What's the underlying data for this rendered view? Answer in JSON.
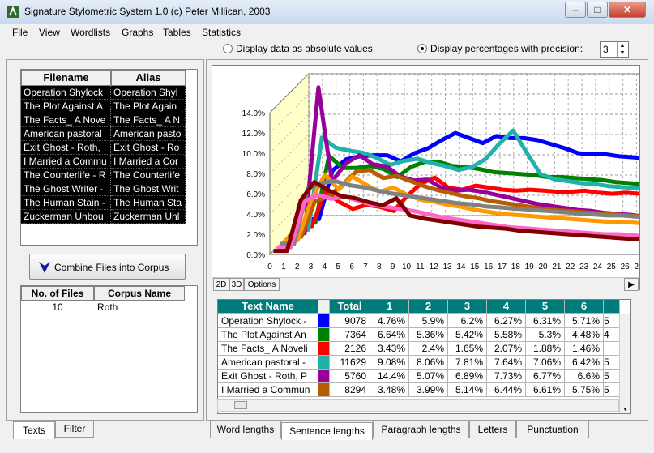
{
  "window": {
    "title": "Signature Stylometric System 1.0  (c) Peter Millican, 2003",
    "min_glyph": "–",
    "max_glyph": "□",
    "close_glyph": "✕"
  },
  "menu": [
    "File",
    "View",
    "Wordlists",
    "Graphs",
    "Tables",
    "Statistics"
  ],
  "options": {
    "absolute_label": "Display data as absolute values",
    "percent_label": "Display percentages with precision:",
    "precision": "3",
    "selected": "percent"
  },
  "file_list": {
    "headers": [
      "Filename",
      "Alias"
    ],
    "rows": [
      [
        "Operation Shylock",
        "Operation Shyl"
      ],
      [
        "The Plot Against A",
        "The Plot Again"
      ],
      [
        "The Facts_ A Nove",
        "The Facts_ A N"
      ],
      [
        "American pastoral",
        "American pasto"
      ],
      [
        "Exit Ghost - Roth,",
        "Exit Ghost - Ro"
      ],
      [
        "I Married a Commu",
        "I Married a Cor"
      ],
      [
        "The Counterlife - R",
        "The Counterlife"
      ],
      [
        "The Ghost Writer -",
        "The Ghost Writ"
      ],
      [
        "The Human Stain -",
        "The Human Sta"
      ],
      [
        "Zuckerman Unbou",
        "Zuckerman Unl"
      ]
    ]
  },
  "combine_button": "Combine Files into Corpus",
  "corpus_table": {
    "headers": [
      "No. of Files",
      "Corpus Name"
    ],
    "rows": [
      [
        "10",
        "Roth"
      ]
    ]
  },
  "left_tabs": [
    "Texts",
    "Filter"
  ],
  "bottom_tabs": [
    "Word lengths",
    "Sentence lengths",
    "Paragraph lengths",
    "Letters",
    "Punctuation"
  ],
  "chart_tabs": [
    "2D",
    "3D",
    "Options"
  ],
  "scroll_right_glyph": "▶",
  "spin_up_glyph": "▲",
  "spin_down_glyph": "▼",
  "scroll_down_glyph": "▼",
  "chart_data": {
    "type": "line",
    "view": "3d",
    "x": [
      0,
      1,
      2,
      3,
      4,
      5,
      6,
      7,
      8,
      9,
      10,
      11,
      12,
      13,
      14,
      15,
      16,
      17,
      18,
      19,
      20,
      21,
      22,
      23,
      24,
      25,
      26,
      27
    ],
    "y_ticks": [
      "0.0%",
      "2.0%",
      "4.0%",
      "6.0%",
      "8.0%",
      "10.0%",
      "12.0%",
      "14.0%"
    ],
    "ylim": [
      0,
      14
    ],
    "grid": true,
    "series": [
      {
        "color": "#0000ff",
        "values": [
          0,
          0,
          4.8,
          5.9,
          6.2,
          6.3,
          6.3,
          5.7,
          6.5,
          7.0,
          7.8,
          8.5,
          8.0,
          7.5,
          8.2,
          8.0,
          8.0,
          7.8,
          7.4,
          7.0,
          6.5,
          6.4,
          6.4,
          6.2,
          6.1,
          6.0,
          6.0,
          5.8
        ]
      },
      {
        "color": "#008000",
        "values": [
          0,
          0,
          6.6,
          5.4,
          5.4,
          5.6,
          5.3,
          4.5,
          5.5,
          6.0,
          6.0,
          5.6,
          5.5,
          5.3,
          5.0,
          4.9,
          4.8,
          4.7,
          4.5,
          4.5,
          4.4,
          4.3,
          4.2,
          4.0,
          3.9,
          3.8,
          3.7,
          3.6
        ]
      },
      {
        "color": "#ff0000",
        "values": [
          0,
          0,
          3.4,
          2.4,
          1.7,
          2.1,
          1.9,
          1.5,
          3.0,
          4.2,
          4.8,
          3.8,
          3.6,
          4.0,
          3.8,
          3.6,
          3.5,
          3.6,
          3.5,
          3.4,
          3.4,
          3.5,
          3.3,
          3.2,
          3.3,
          3.2,
          3.1,
          3.0
        ]
      },
      {
        "color": "#20b2aa",
        "values": [
          0,
          0,
          9.1,
          8.1,
          7.8,
          7.6,
          7.1,
          6.4,
          6.8,
          7.0,
          6.6,
          6.3,
          5.9,
          6.2,
          7.0,
          8.5,
          9.8,
          7.6,
          5.5,
          5.0,
          4.8,
          4.6,
          4.5,
          4.3,
          4.2,
          4.1,
          4.0,
          3.9
        ]
      },
      {
        "color": "#990099",
        "values": [
          0,
          0,
          14.4,
          5.1,
          6.9,
          7.7,
          6.8,
          6.6,
          5.6,
          5.2,
          5.3,
          4.5,
          4.2,
          4.3,
          4.1,
          3.8,
          3.5,
          3.2,
          2.9,
          2.7,
          2.5,
          2.3,
          2.2,
          2.0,
          1.9,
          1.8,
          1.6,
          1.5
        ]
      },
      {
        "color": "#b85c00",
        "values": [
          0,
          0,
          3.5,
          4.0,
          5.1,
          6.4,
          6.6,
          5.8,
          6.0,
          5.5,
          5.0,
          4.6,
          4.3,
          4.0,
          3.8,
          3.5,
          3.3,
          3.1,
          2.9,
          2.7,
          2.6,
          2.5,
          2.4,
          2.3,
          2.2,
          2.1,
          2.0,
          1.9
        ]
      },
      {
        "color": "#ff9900",
        "values": [
          0,
          0,
          4.0,
          6.5,
          5.0,
          6.3,
          5.5,
          4.8,
          5.2,
          4.5,
          4.0,
          3.8,
          3.5,
          3.3,
          3.0,
          2.8,
          2.6,
          2.5,
          2.4,
          2.3,
          2.2,
          2.1,
          2.0,
          1.9,
          1.8,
          1.8,
          1.7,
          1.6
        ]
      },
      {
        "color": "#808080",
        "values": [
          0,
          0,
          5.5,
          6.0,
          6.2,
          5.8,
          5.6,
          5.3,
          5.0,
          4.8,
          4.6,
          4.4,
          4.2,
          4.0,
          3.9,
          3.7,
          3.6,
          3.5,
          3.4,
          3.3,
          3.2,
          3.1,
          3.0,
          2.9,
          2.8,
          2.8,
          2.7,
          2.6
        ]
      },
      {
        "color": "#ff66cc",
        "values": [
          0,
          0,
          4.5,
          5.2,
          4.8,
          5.0,
          4.6,
          4.2,
          4.0,
          3.8,
          3.6,
          3.3,
          3.0,
          2.8,
          2.6,
          2.4,
          2.2,
          2.0,
          1.9,
          1.8,
          1.7,
          1.6,
          1.5,
          1.4,
          1.3,
          1.3,
          1.2,
          1.1
        ]
      },
      {
        "color": "#800000",
        "values": [
          0,
          0,
          5.0,
          6.8,
          6.0,
          5.4,
          5.2,
          4.8,
          4.5,
          5.2,
          3.5,
          3.2,
          3.0,
          2.8,
          2.6,
          2.4,
          2.3,
          2.2,
          2.0,
          1.9,
          1.8,
          1.7,
          1.6,
          1.5,
          1.4,
          1.3,
          1.2,
          1.1
        ]
      }
    ]
  },
  "data_grid": {
    "headers": [
      "Text Name",
      "",
      "Total",
      "1",
      "2",
      "3",
      "4",
      "5",
      "6"
    ],
    "rows": [
      {
        "name": "Operation Shylock -",
        "color": "#0000ff",
        "total": "9078",
        "vals": [
          "4.76%",
          "5.9%",
          "6.2%",
          "6.27%",
          "6.31%",
          "5.71%",
          "5"
        ]
      },
      {
        "name": "The Plot Against An",
        "color": "#008000",
        "total": "7364",
        "vals": [
          "6.64%",
          "5.36%",
          "5.42%",
          "5.58%",
          "5.3%",
          "4.48%",
          "4"
        ]
      },
      {
        "name": "The Facts_ A Noveli",
        "color": "#ff0000",
        "total": "2126",
        "vals": [
          "3.43%",
          "2.4%",
          "1.65%",
          "2.07%",
          "1.88%",
          "1.46%",
          ""
        ]
      },
      {
        "name": "American pastoral -",
        "color": "#20b2aa",
        "total": "11629",
        "vals": [
          "9.08%",
          "8.06%",
          "7.81%",
          "7.64%",
          "7.06%",
          "6.42%",
          "5"
        ]
      },
      {
        "name": "Exit Ghost - Roth, P",
        "color": "#990099",
        "total": "5760",
        "vals": [
          "14.4%",
          "5.07%",
          "6.89%",
          "7.73%",
          "6.77%",
          "6.6%",
          "5"
        ]
      },
      {
        "name": "I Married a Commun",
        "color": "#b85c00",
        "total": "8294",
        "vals": [
          "3.48%",
          "3.99%",
          "5.14%",
          "6.44%",
          "6.61%",
          "5.75%",
          "5"
        ]
      }
    ]
  }
}
